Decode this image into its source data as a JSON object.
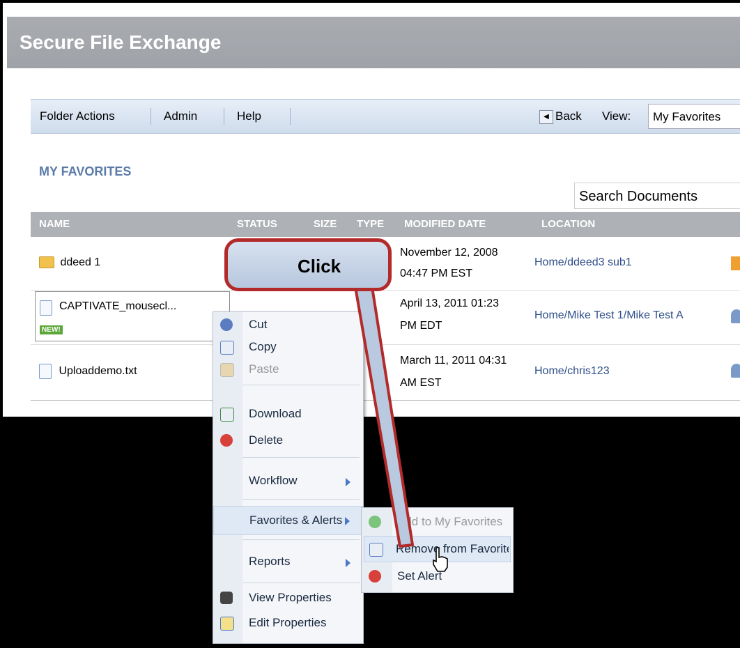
{
  "app": {
    "title": "Secure File Exchange"
  },
  "toolbar": {
    "folder_actions": "Folder Actions",
    "admin": "Admin",
    "help": "Help",
    "back": "Back",
    "view_label": "View:",
    "view_value": "My Favorites"
  },
  "section": {
    "title": "MY FAVORITES"
  },
  "search": {
    "placeholder": "Search Documents"
  },
  "table": {
    "headers": [
      "NAME",
      "STATUS",
      "SIZE",
      "TYPE",
      "MODIFIED DATE",
      "LOCATION"
    ],
    "rows": [
      {
        "name": "ddeed 1",
        "type": "Folder",
        "date_line1": "November 12, 2008",
        "date_line2": "04:47 PM EST",
        "location": "Home/ddeed3 sub1"
      },
      {
        "name": "CAPTIVATE_mousecl...",
        "badge": "NEW!",
        "date_line1": "April 13, 2011 01:23",
        "date_line2": "PM EDT",
        "location": "Home/Mike Test 1/Mike Test A"
      },
      {
        "name": "Uploaddemo.txt",
        "date_line1": "March 11, 2011 04:31",
        "date_line2": "AM EST",
        "location": "Home/chris123"
      }
    ]
  },
  "context_menu": {
    "cut": "Cut",
    "copy": "Copy",
    "paste": "Paste",
    "download": "Download",
    "delete": "Delete",
    "workflow": "Workflow",
    "favorites_alerts": "Favorites & Alerts",
    "reports": "Reports",
    "view_properties": "View Properties",
    "edit_properties": "Edit Properties"
  },
  "submenu": {
    "add": "Add to My Favorites",
    "remove": "Remove from Favorites",
    "set_alert": "Set Alert"
  },
  "callout": {
    "text": "Click"
  },
  "colors": {
    "accent": "#b22a2a",
    "header_gray": "#a9abb0",
    "link": "#2f4f8a"
  }
}
